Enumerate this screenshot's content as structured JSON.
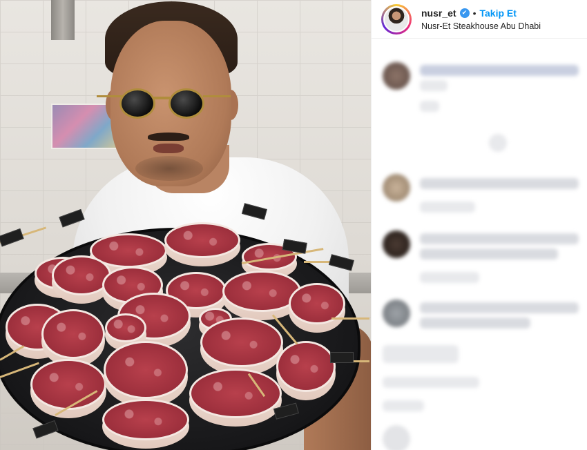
{
  "post": {
    "username": "nusr_et",
    "verified": true,
    "separator": "•",
    "follow_label": "Takip Et",
    "location": "Nusr-Et Steakhouse Abu Dhabi"
  },
  "icons": {
    "verified": "verified-badge-icon"
  },
  "colors": {
    "follow": "#0095f6",
    "verified": "#3897f0",
    "text": "#262626"
  }
}
